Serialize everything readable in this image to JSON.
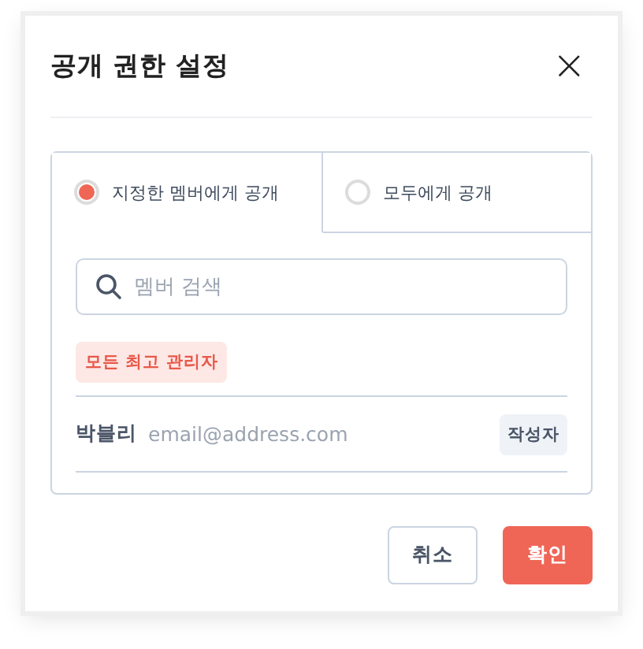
{
  "dialog": {
    "title": "공개 권한 설정",
    "close": "×"
  },
  "options": [
    {
      "label": "지정한 멤버에게 공개",
      "selected": true
    },
    {
      "label": "모두에게 공개",
      "selected": false
    }
  ],
  "search": {
    "placeholder": "멤버 검색"
  },
  "group_tag": "모든 최고 관리자",
  "members": [
    {
      "name": "박블리",
      "email": "email@address.com",
      "role": "작성자"
    }
  ],
  "buttons": [
    {
      "label": "취소",
      "kind": "secondary"
    },
    {
      "label": "확인",
      "kind": "primary"
    }
  ]
}
